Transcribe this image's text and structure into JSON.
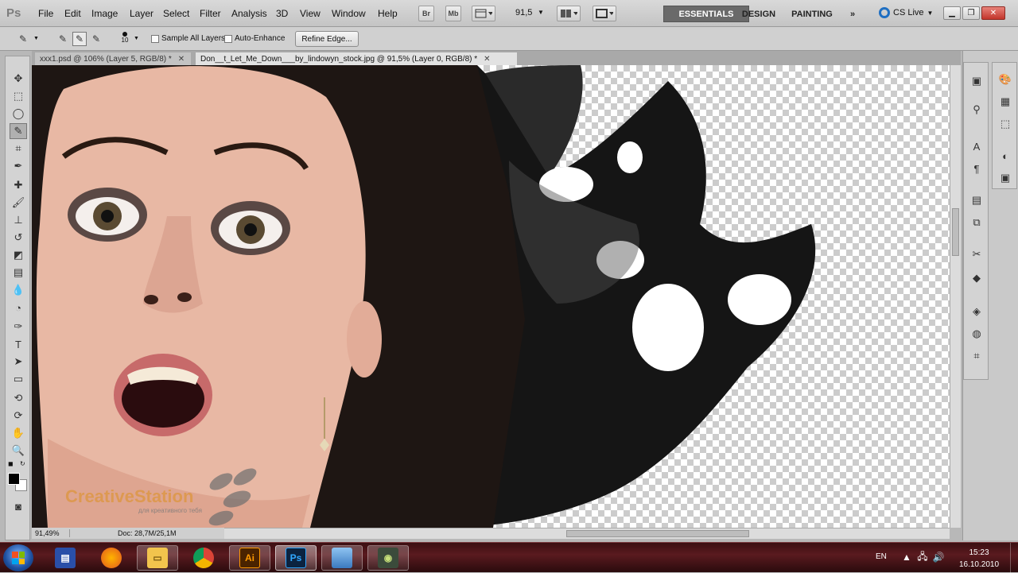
{
  "app": {
    "logo": "Ps"
  },
  "menu": [
    "File",
    "Edit",
    "Image",
    "Layer",
    "Select",
    "Filter",
    "Analysis",
    "3D",
    "View",
    "Window",
    "Help"
  ],
  "appbar": {
    "bridge": "Br",
    "minibridge": "Mb",
    "zoom": "91,5"
  },
  "workspaces": {
    "essentials": "ESSENTIALS",
    "design": "DESIGN",
    "painting": "PAINTING",
    "more": "»"
  },
  "cslive": "CS Live",
  "options": {
    "brush_size": "10",
    "sample_all_layers": "Sample All Layers",
    "auto_enhance": "Auto-Enhance",
    "refine_edge": "Refine Edge..."
  },
  "tabs": [
    {
      "label": "ххх1.psd @ 106% (Layer 5, RGB/8) *"
    },
    {
      "label": "Don__t_Let_Me_Down___by_lindowyn_stock.jpg @ 91,5% (Layer 0, RGB/8) *"
    }
  ],
  "status": {
    "zoom": "91,49%",
    "doc": "Doc: 28,7M/25,1M"
  },
  "watermark": {
    "brand": "CreativeStation",
    "sub": "для креативного тебя"
  },
  "taskbar": {
    "lang": "EN",
    "time": "15:23",
    "date": "16.10.2010"
  },
  "colors": {
    "accent_ps": "#1f3a5c",
    "workspace_active": "#6a6a6a",
    "taskbar": "#4a1418"
  },
  "tools": [
    "move-icon",
    "marquee-icon",
    "lasso-icon",
    "quick-selection-icon",
    "crop-icon",
    "eyedropper-icon",
    "spot-healing-icon",
    "brush-icon",
    "clone-stamp-icon",
    "history-brush-icon",
    "eraser-icon",
    "gradient-icon",
    "blur-icon",
    "dodge-icon",
    "pen-icon",
    "type-icon",
    "path-selection-icon",
    "rectangle-icon",
    "3d-rotate-icon",
    "3d-orbit-icon",
    "hand-icon",
    "zoom-icon"
  ]
}
